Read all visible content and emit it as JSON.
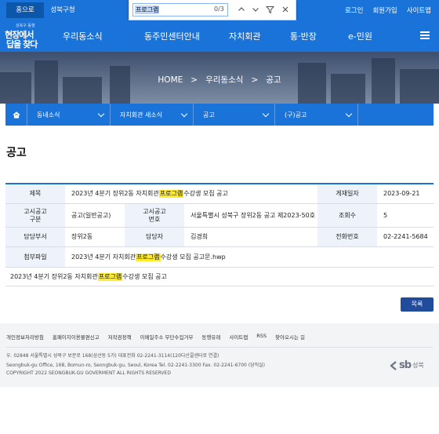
{
  "topbar": {
    "tabs": [
      "홈으로",
      "성북구청"
    ],
    "util_links": [
      "로그인",
      "회원가입",
      "사이트맵"
    ]
  },
  "findbar": {
    "query": "프로그램",
    "count": "0/3"
  },
  "logo": {
    "small_text": "성북구 동행",
    "line1": "현장에서",
    "line2": "답을 찾다"
  },
  "nav": {
    "items": [
      "우리동소식",
      "동주민센터안내",
      "자치회관",
      "통·반장",
      "e-민원"
    ]
  },
  "hero": {
    "breadcrumb": [
      "HOME",
      "우리동소식",
      "공고"
    ],
    "separator": ">"
  },
  "subnav": {
    "items": [
      "동네소식",
      "자치회관 새소식",
      "공고",
      "(구)공고"
    ]
  },
  "page_title": "공고",
  "post": {
    "title_label": "제목",
    "title_pre": "2023년 4분기 장위2동 자치회관 ",
    "title_hl": "프로그램",
    "title_post": " 수강생 모집 공고",
    "date_label": "게재일자",
    "date": "2023-09-21",
    "category_label": "고시공고\n구분",
    "category": "공고(일반공고)",
    "number_label": "고시공고\n번호",
    "number": "서울특별시 성북구 장위2동 공고 제2023-50호",
    "views_label": "조회수",
    "views": "5",
    "dept_label": "담당부서",
    "dept": "장위2동",
    "manager_label": "담당자",
    "manager": "김경희",
    "phone_label": "전화번호",
    "phone": "02-2241-5684",
    "attach_label": "첨부파일",
    "attach_pre": "2023년 4분기 자치회관 ",
    "attach_hl": "프로그램",
    "attach_post": " 수강생 모집 공고문.hwp",
    "content_pre": "2023년 4분기 장위2동 자치회관 ",
    "content_hl": "프로그램",
    "content_post": " 수강생 모집 공고"
  },
  "list_button": "목록",
  "footer": {
    "links": [
      "개인정보처리방침",
      "홈페이지이용불편신고",
      "저작권정책",
      "이메일주소 무단수집거부",
      "동행유래",
      "사이트맵",
      "RSS",
      "찾아오시는 길"
    ],
    "address_ko": "우. 02848 서울특별시 성북구 보문로 168(삼선동 5가) 대표전화 02-2241-3114(120다산콜센터로 연결)",
    "address_en": "Seongbuk-gu Office, 168, Bomun-ro, Seongbuk-gu, Seoul, Korea Tel. 02-2241-3300 Fax. 02-2241-6700 (당직실)",
    "copyright": "COPYRIGHT 2022 SEONGBUK-GU GOVERMENT ALL RIGHTS RESERVED",
    "logo_mark": "sb",
    "logo_name": "성북"
  },
  "colors": {
    "primary": "#1a73d9",
    "dark_button": "#214b9b",
    "highlight": "#ffeb2d",
    "header_cell": "#edf2fb"
  }
}
